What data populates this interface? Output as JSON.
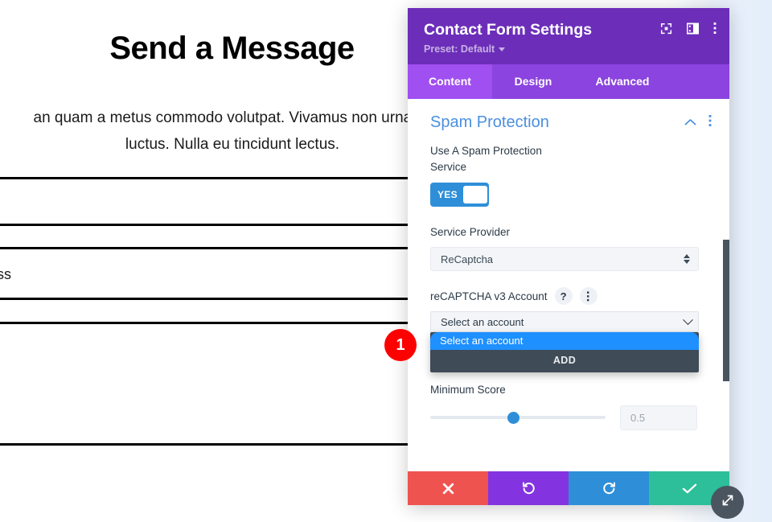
{
  "background_page": {
    "heading": "Send a Message",
    "paragraph": "an quam a metus commodo volutpat. Vivamus non urna sit luctus. Nulla eu tincidunt lectus.",
    "paragraph_line1": "an quam a metus commodo volutpat. Vivamus non urna sit",
    "paragraph_line2": "luctus. Nulla eu tincidunt lectus.",
    "field_text": "ess"
  },
  "modal": {
    "title": "Contact Form Settings",
    "preset_label": "Preset: Default",
    "header_icons": [
      {
        "name": "focus-icon"
      },
      {
        "name": "layout-panel-icon"
      },
      {
        "name": "more-vertical-icon"
      }
    ],
    "tabs": [
      {
        "label": "Content",
        "active": true
      },
      {
        "label": "Design",
        "active": false
      },
      {
        "label": "Advanced",
        "active": false
      }
    ],
    "section": {
      "title": "Spam Protection",
      "collapse_icon": "chevron-up-icon",
      "more_icon": "more-vertical-icon"
    },
    "fields": {
      "use_spam_service": {
        "label": "Use A Spam Protection Service",
        "toggle_value": "YES",
        "enabled": true
      },
      "service_provider": {
        "label": "Service Provider",
        "value": "ReCaptcha",
        "options": [
          "ReCaptcha"
        ]
      },
      "recaptcha_account": {
        "label": "reCAPTCHA v3 Account",
        "help_glyph": "?",
        "more_icon": "more-vertical-icon",
        "value": "Select an account",
        "dropdown_open": true,
        "options": [
          "Select an account"
        ],
        "add_button_label": "ADD"
      },
      "minimum_score": {
        "label": "Minimum Score",
        "value": "0.5",
        "slider_percent": 44
      }
    },
    "footer_buttons": [
      {
        "name": "cancel-button",
        "icon": "close-icon",
        "color": "#ef5350"
      },
      {
        "name": "undo-button",
        "icon": "undo-icon",
        "color": "#8334e0"
      },
      {
        "name": "redo-button",
        "icon": "redo-icon",
        "color": "#2e8fd8"
      },
      {
        "name": "save-button",
        "icon": "check-icon",
        "color": "#2dbe9a"
      }
    ],
    "resize_handle_icon": "resize-diagonal-icon",
    "scrollbar": {
      "thumb_top_pct": 28,
      "thumb_height_pct": 40
    }
  },
  "annotations": [
    {
      "label": "1",
      "color": "#ff0000"
    }
  ],
  "colors": {
    "header_purple": "#6c2eb9",
    "tabbar_purple": "#8b44df",
    "tab_active_purple": "#a04ff0",
    "section_title_blue": "#4a8fe0",
    "toggle_blue": "#2e8fd8",
    "dropdown_highlight_blue": "#1e90ff",
    "dropdown_dark": "#3f4b57"
  }
}
